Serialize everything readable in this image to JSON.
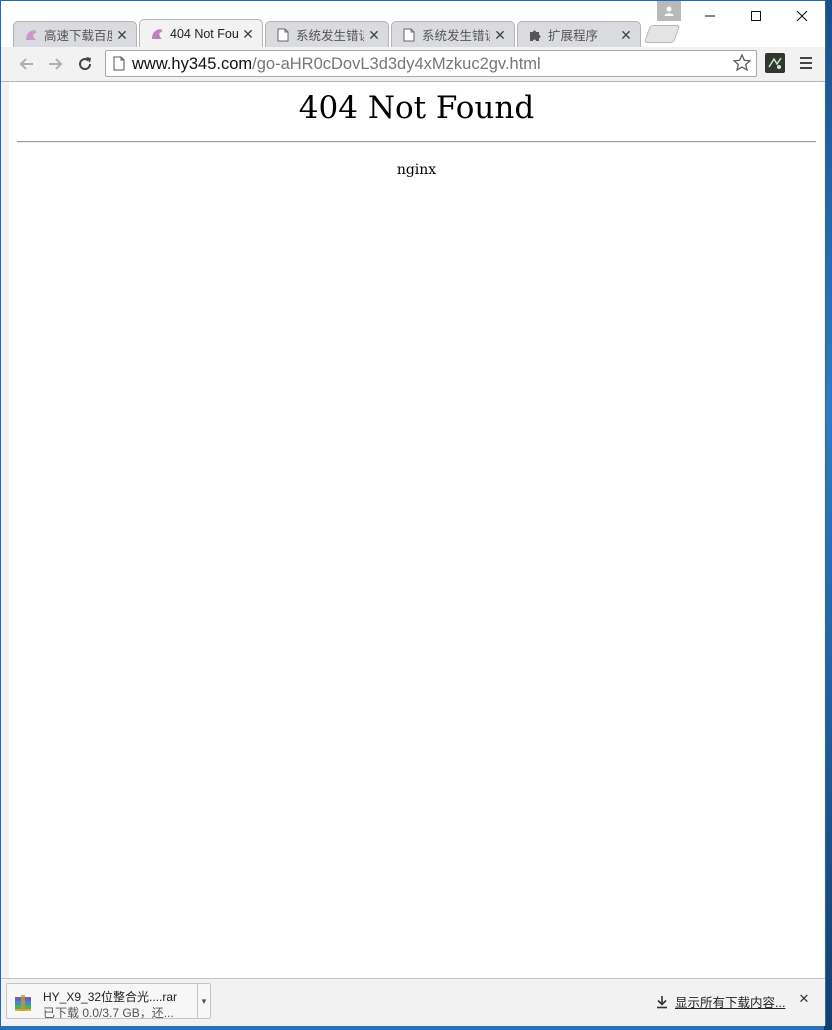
{
  "tabs": [
    {
      "title": "高速下载百度",
      "icon": "baidu-icon",
      "active": false
    },
    {
      "title": "404 Not Fou",
      "icon": "baidu-icon",
      "active": true
    },
    {
      "title": "系统发生错误",
      "icon": "page-icon",
      "active": false
    },
    {
      "title": "系统发生错误",
      "icon": "page-icon",
      "active": false
    },
    {
      "title": "扩展程序",
      "icon": "puzzle-icon",
      "active": false
    }
  ],
  "omnibox": {
    "host": "www.hy345.com",
    "path": "/go-aHR0cDovL3d3dy4xMzkuc2gv.html"
  },
  "page": {
    "heading": "404 Not Found",
    "server": "nginx"
  },
  "download_shelf": {
    "file_name": "HY_X9_32位整合光....rar",
    "status": "已下载 0.0/3.7 GB，还...",
    "show_all": "显示所有下载内容..."
  },
  "colors": {
    "window_frame": "#1e6ab5",
    "toolbar_bg": "#f2f2f2",
    "tab_inactive": "#dadbde"
  }
}
